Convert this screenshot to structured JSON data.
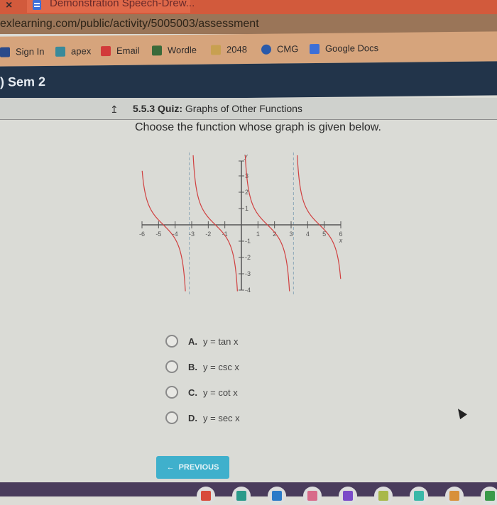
{
  "browser": {
    "tab_close_label": "×",
    "tab_title": "Demonstration Speech-Drew...",
    "url": "exlearning.com/public/activity/5005003/assessment",
    "bookmarks": [
      {
        "label": "Sign In",
        "icon": "sign-in-icon",
        "color": "#2a4a8a"
      },
      {
        "label": "apex",
        "icon": "apex-icon",
        "color": "#3a8a9a"
      },
      {
        "label": "Email",
        "icon": "gmail-icon",
        "color": "#d23a3a"
      },
      {
        "label": "Wordle",
        "icon": "wordle-icon",
        "color": "#3a6a3a"
      },
      {
        "label": "2048",
        "icon": "game-2048-icon",
        "color": "#c8a050"
      },
      {
        "label": "CMG",
        "icon": "cmg-icon",
        "color": "#2a5aaa"
      },
      {
        "label": "Google Docs",
        "icon": "google-docs-icon",
        "color": "#3c6fd8"
      }
    ]
  },
  "course": {
    "title": ") Sem 2"
  },
  "quiz": {
    "arrow": "↥",
    "number": "5.5.3",
    "type": "Quiz:",
    "title": "Graphs of Other Functions",
    "question": "Choose the function whose graph is given below."
  },
  "chart_data": {
    "type": "line",
    "function": "cot x",
    "xlabel": "x",
    "ylabel": "y",
    "xlim": [
      -6,
      6
    ],
    "ylim": [
      -4,
      4
    ],
    "x_ticks": [
      -6,
      -5,
      -4,
      -3,
      -2,
      -1,
      1,
      2,
      3,
      4,
      5,
      6
    ],
    "y_ticks": [
      -4,
      -3,
      -2,
      -1,
      1,
      2,
      3
    ],
    "asymptotes": [
      -3.1416,
      3.1416
    ],
    "line_color": "#d04040",
    "asymptote_color": "#7a9ab0"
  },
  "choices": [
    {
      "letter": "A.",
      "text": "y = tan x"
    },
    {
      "letter": "B.",
      "text": "y = csc x"
    },
    {
      "letter": "C.",
      "text": "y = cot x"
    },
    {
      "letter": "D.",
      "text": "y = sec x"
    }
  ],
  "nav": {
    "previous_label": "PREVIOUS",
    "previous_icon": "←"
  },
  "shelf_apps": [
    {
      "name": "chrome",
      "color": "#d84a3a"
    },
    {
      "name": "meet",
      "color": "#2a9a8a"
    },
    {
      "name": "app-blue",
      "color": "#2a7ac8"
    },
    {
      "name": "app-pink",
      "color": "#d86a8a"
    },
    {
      "name": "app-purple",
      "color": "#7a4ac8"
    },
    {
      "name": "app-olive",
      "color": "#a8b84a"
    },
    {
      "name": "app-teal",
      "color": "#3ab8a8"
    },
    {
      "name": "app-orange",
      "color": "#d8903a"
    },
    {
      "name": "classroom",
      "color": "#3a9a4a"
    }
  ]
}
